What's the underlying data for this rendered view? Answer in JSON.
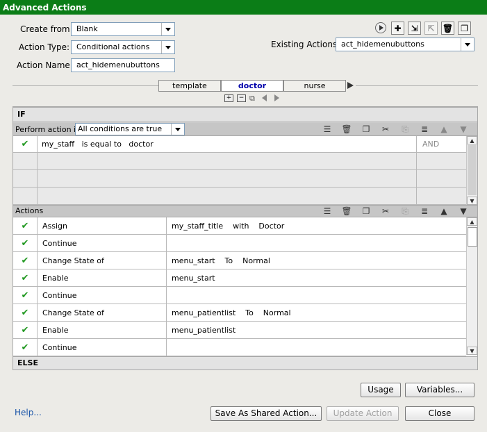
{
  "window": {
    "title": "Advanced Actions"
  },
  "form": {
    "create_from_label": "Create from:",
    "create_from_value": "Blank",
    "action_type_label": "Action Type:",
    "action_type_value": "Conditional actions",
    "action_name_label": "Action Name:",
    "action_name_value": "act_hidemenubuttons",
    "existing_actions_label": "Existing Actions:",
    "existing_actions_value": "act_hidemenubuttons"
  },
  "toolbar_icons": [
    "play-icon",
    "add-icon",
    "import-icon",
    "export-icon",
    "delete-icon",
    "duplicate-icon"
  ],
  "tabs": [
    {
      "label": "template",
      "active": false
    },
    {
      "label": "doctor",
      "active": true
    },
    {
      "label": "nurse",
      "active": false
    }
  ],
  "if_section": {
    "title": "IF",
    "perform_label": "Perform action if:",
    "condition_mode": "All conditions are true",
    "rows": [
      {
        "checked": true,
        "expression": "my_staff   is equal to   doctor",
        "logic": "AND"
      },
      {
        "checked": false,
        "expression": "",
        "logic": ""
      },
      {
        "checked": false,
        "expression": "",
        "logic": ""
      },
      {
        "checked": false,
        "expression": "",
        "logic": ""
      }
    ]
  },
  "actions_section": {
    "title": "Actions",
    "rows": [
      {
        "checked": true,
        "action": "Assign",
        "target": "my_staff_title    with    Doctor"
      },
      {
        "checked": true,
        "action": "Continue",
        "target": ""
      },
      {
        "checked": true,
        "action": "Change State of",
        "target": "menu_start    To    Normal"
      },
      {
        "checked": true,
        "action": "Enable",
        "target": "menu_start"
      },
      {
        "checked": true,
        "action": "Continue",
        "target": ""
      },
      {
        "checked": true,
        "action": "Change State of",
        "target": "menu_patientlist    To    Normal"
      },
      {
        "checked": true,
        "action": "Enable",
        "target": "menu_patientlist"
      },
      {
        "checked": true,
        "action": "Continue",
        "target": ""
      }
    ]
  },
  "else_section": {
    "title": "ELSE"
  },
  "buttons": {
    "usage": "Usage",
    "variables": "Variables...",
    "help": "Help...",
    "save_shared": "Save As Shared Action...",
    "update": "Update Action",
    "close": "Close"
  },
  "colors": {
    "titlebar": "#0b7d17",
    "check": "#229922",
    "active_tab": "#0000aa"
  }
}
